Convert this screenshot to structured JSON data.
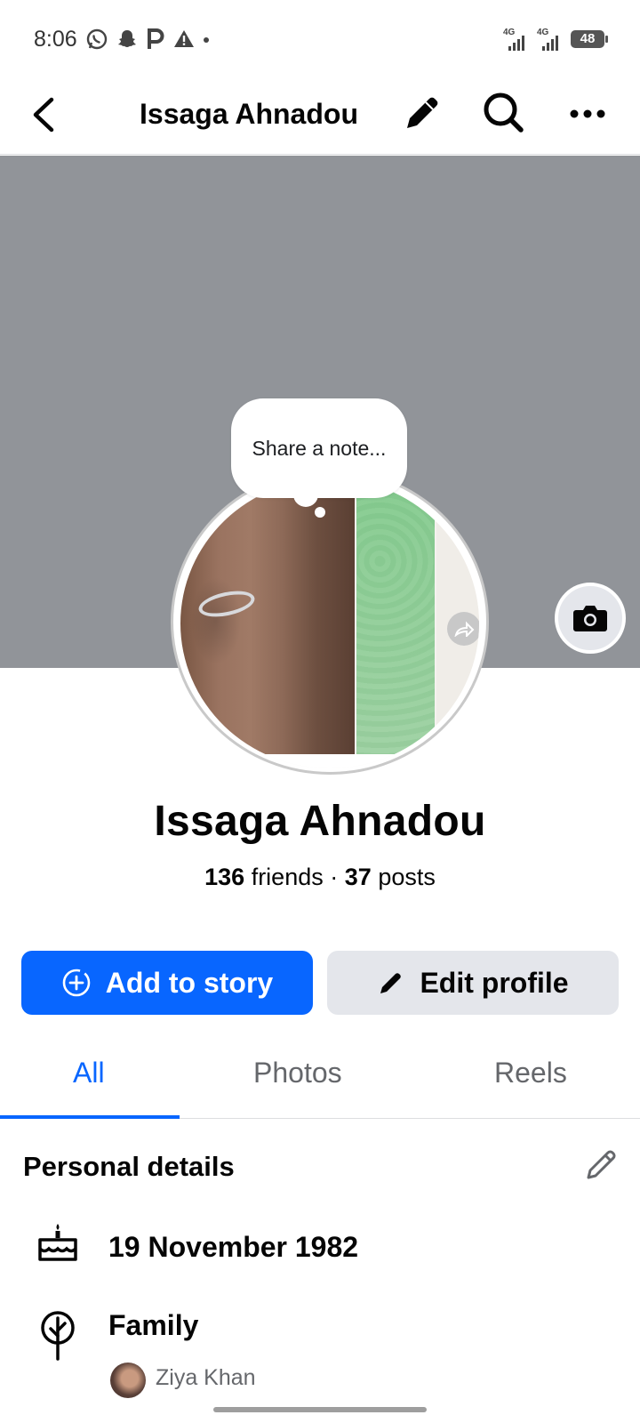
{
  "status_bar": {
    "time": "8:06",
    "network_1": "4G",
    "network_2": "4G",
    "battery": "48"
  },
  "nav": {
    "title": "Issaga Ahnadou"
  },
  "note": {
    "placeholder": "Share a note..."
  },
  "profile": {
    "name": "Issaga Ahnadou",
    "friends_count": "136",
    "friends_label": "friends",
    "separator": "·",
    "posts_count": "37",
    "posts_label": "posts"
  },
  "actions": {
    "add_story": "Add to story",
    "edit_profile": "Edit profile"
  },
  "tabs": [
    {
      "label": "All",
      "active": true
    },
    {
      "label": "Photos",
      "active": false
    },
    {
      "label": "Reels",
      "active": false
    }
  ],
  "personal_details": {
    "title": "Personal details",
    "birthday": "19 November 1982",
    "family_label": "Family",
    "family_member": "Ziya Khan"
  },
  "colors": {
    "brand_blue": "#0866ff",
    "cover_gray": "#919499",
    "secondary_button": "#e4e6eb"
  }
}
